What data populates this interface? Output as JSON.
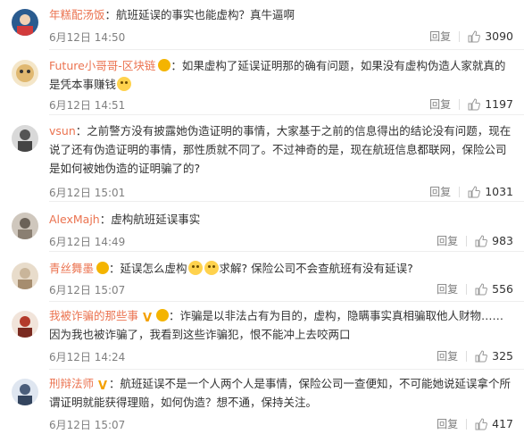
{
  "comments": [
    {
      "user": "年糕配汤饭",
      "body": "：航班延误的事实也能虚构？真牛逼啊",
      "time": "6月12日 14:50",
      "reply": "回复",
      "likes": "3090",
      "avatar_color": "#2a5b8f"
    },
    {
      "user": "Future小哥哥-区块链",
      "badges": [
        "vip-badge-icon"
      ],
      "body": "：如果虚构了延误证明那的确有问题，如果没有虚构伪造人家就真的是凭本事赚钱",
      "body_emojis": 1,
      "time": "6月12日 14:51",
      "reply": "回复",
      "likes": "1197",
      "avatar_color": "#e8d2a6"
    },
    {
      "user": "vsun",
      "body": "：之前警方没有披露她伪造证明的事情，大家基于之前的信息得出的结论没有问题，现在说了还有伪造证明的事情，那性质就不同了。不过神奇的是，现在航班信息都联网，保险公司是如何被她伪造的证明骗了的?",
      "time": "6月12日 15:01",
      "reply": "回复",
      "likes": "1031",
      "avatar_color": "#555555"
    },
    {
      "user": "AlexMajh",
      "body": "：虚构航班延误事实",
      "time": "6月12日 14:49",
      "reply": "回复",
      "likes": "983",
      "avatar_color": "#6b6258"
    },
    {
      "user": "青丝舞墨",
      "badges": [
        "vip-badge-icon"
      ],
      "body_before": "：延误怎么虚构",
      "body_after": "求解? 保险公司不会查航班有没有延误?",
      "body_emojis": 2,
      "time": "6月12日 15:07",
      "reply": "回复",
      "likes": "556",
      "avatar_color": "#c9b59a"
    },
    {
      "user": "我被诈骗的那些事",
      "badges": [
        "verified-v-icon",
        "vip-badge-icon"
      ],
      "body": "：诈骗是以非法占有为目的，虚构，隐瞒事实真相骗取他人财物……因为我也被诈骗了，我看到这些诈骗犯，恨不能冲上去咬两口",
      "time": "6月12日 14:24",
      "reply": "回复",
      "likes": "325",
      "avatar_color": "#b33a2b"
    },
    {
      "user": "刑辩法师",
      "badges": [
        "verified-v-icon"
      ],
      "body": "：航班延误不是一个人两个人是事情，保险公司一查便知，不可能她说延误拿个所谓证明就能获得理赔，如何伪造？想不通，保持关注。",
      "time": "6月12日 15:07",
      "reply": "回复",
      "likes": "417",
      "avatar_color": "#4a5d7a"
    }
  ],
  "colors": {
    "username": "#eb7350",
    "meta": "#808080",
    "text": "#333333"
  }
}
